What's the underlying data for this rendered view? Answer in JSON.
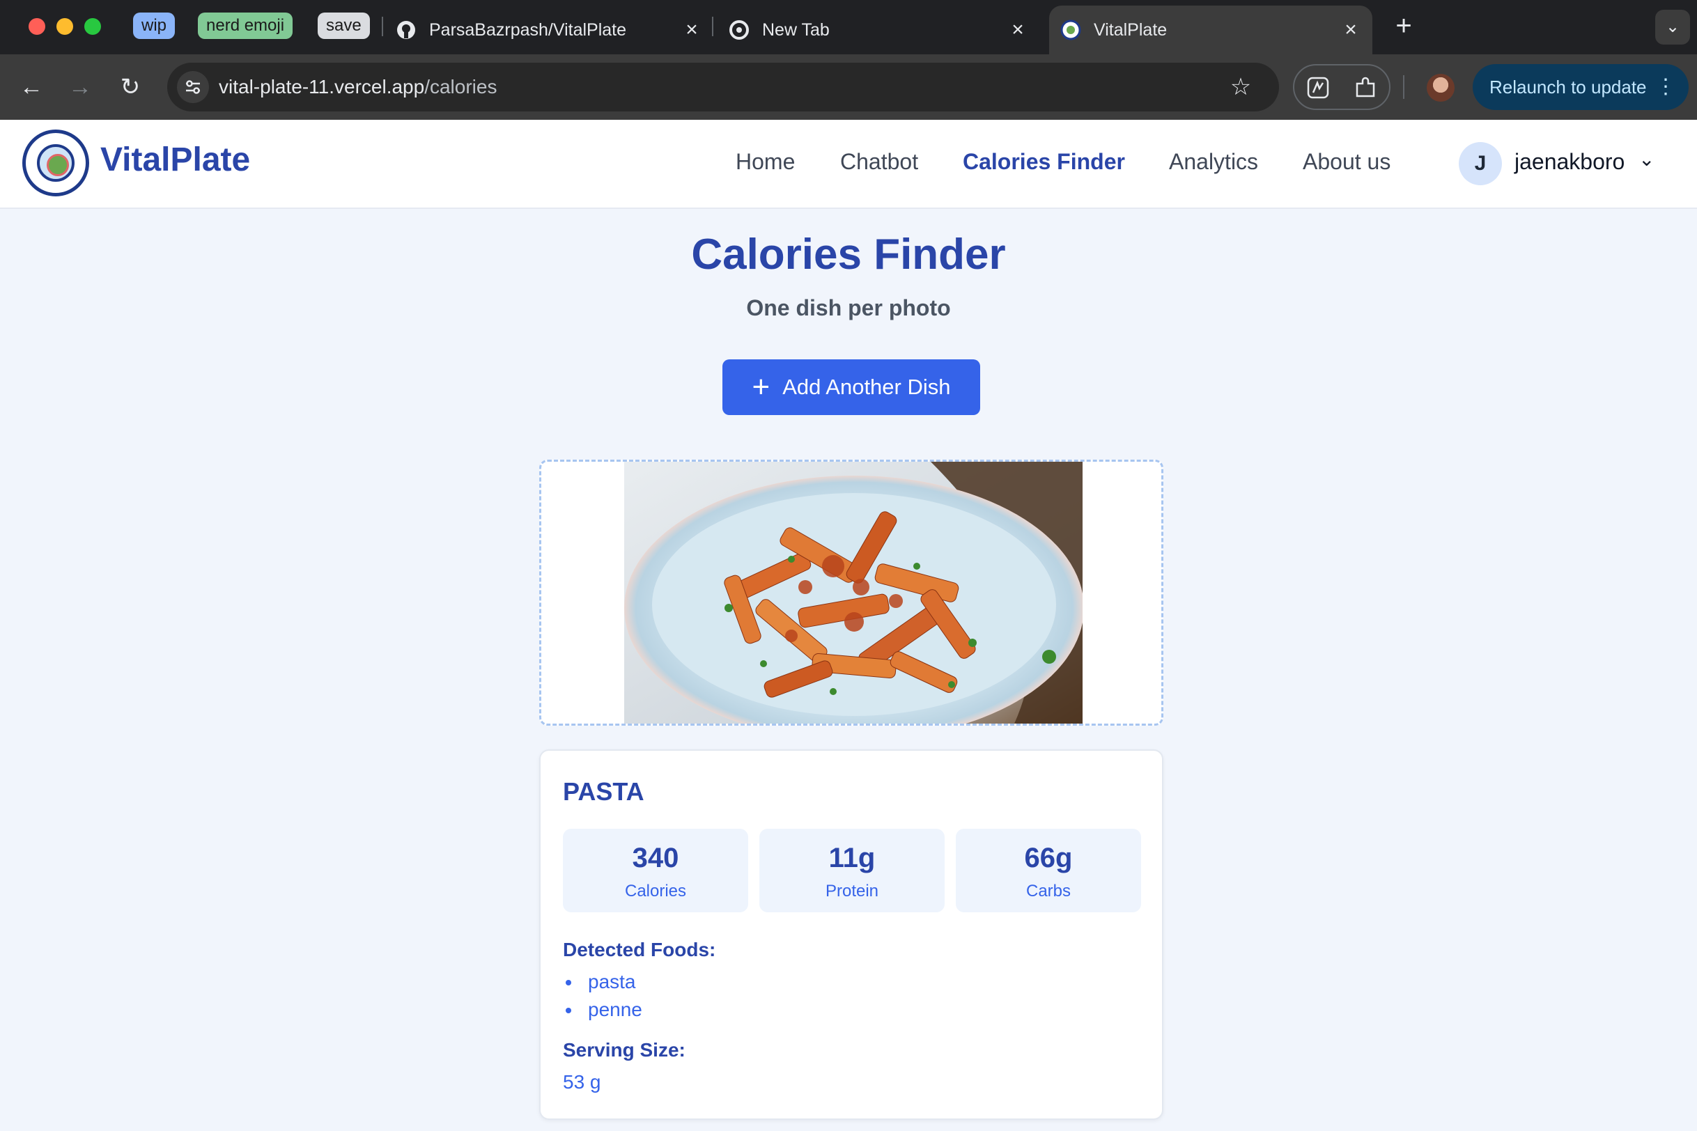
{
  "browser": {
    "tab_groups": [
      {
        "label": "wip",
        "color": "#8ab4f8"
      },
      {
        "label": "nerd emoji",
        "color": "#81c995"
      },
      {
        "label": "save",
        "color": "#dadce0"
      }
    ],
    "tabs": [
      {
        "title": "ParsaBazrpash/VitalPlate",
        "icon": "github-icon"
      },
      {
        "title": "New Tab",
        "icon": "chrome-icon"
      },
      {
        "title": "VitalPlate",
        "icon": "vitalplate-favicon",
        "active": true
      }
    ],
    "url_host": "vital-plate-11.vercel.app",
    "url_path": "/calories",
    "relaunch_label": "Relaunch to update"
  },
  "app": {
    "brand": "VitalPlate",
    "nav": [
      {
        "label": "Home"
      },
      {
        "label": "Chatbot"
      },
      {
        "label": "Calories Finder",
        "active": true
      },
      {
        "label": "Analytics"
      },
      {
        "label": "About us"
      }
    ],
    "user": {
      "initial": "J",
      "name": "jaenakboro"
    }
  },
  "main": {
    "title": "Calories Finder",
    "subtitle": "One dish per photo",
    "add_button": "Add Another Dish"
  },
  "result": {
    "dish": "PASTA",
    "stats": [
      {
        "value": "340",
        "label": "Calories"
      },
      {
        "value": "11g",
        "label": "Protein"
      },
      {
        "value": "66g",
        "label": "Carbs"
      }
    ],
    "detected_heading": "Detected Foods:",
    "detected_foods": [
      "pasta",
      "penne"
    ],
    "serving_heading": "Serving Size:",
    "serving_value": "53 g"
  },
  "colors": {
    "brand_blue": "#2a45a8",
    "button_blue": "#3563e9",
    "page_bg": "#f1f5fc"
  }
}
